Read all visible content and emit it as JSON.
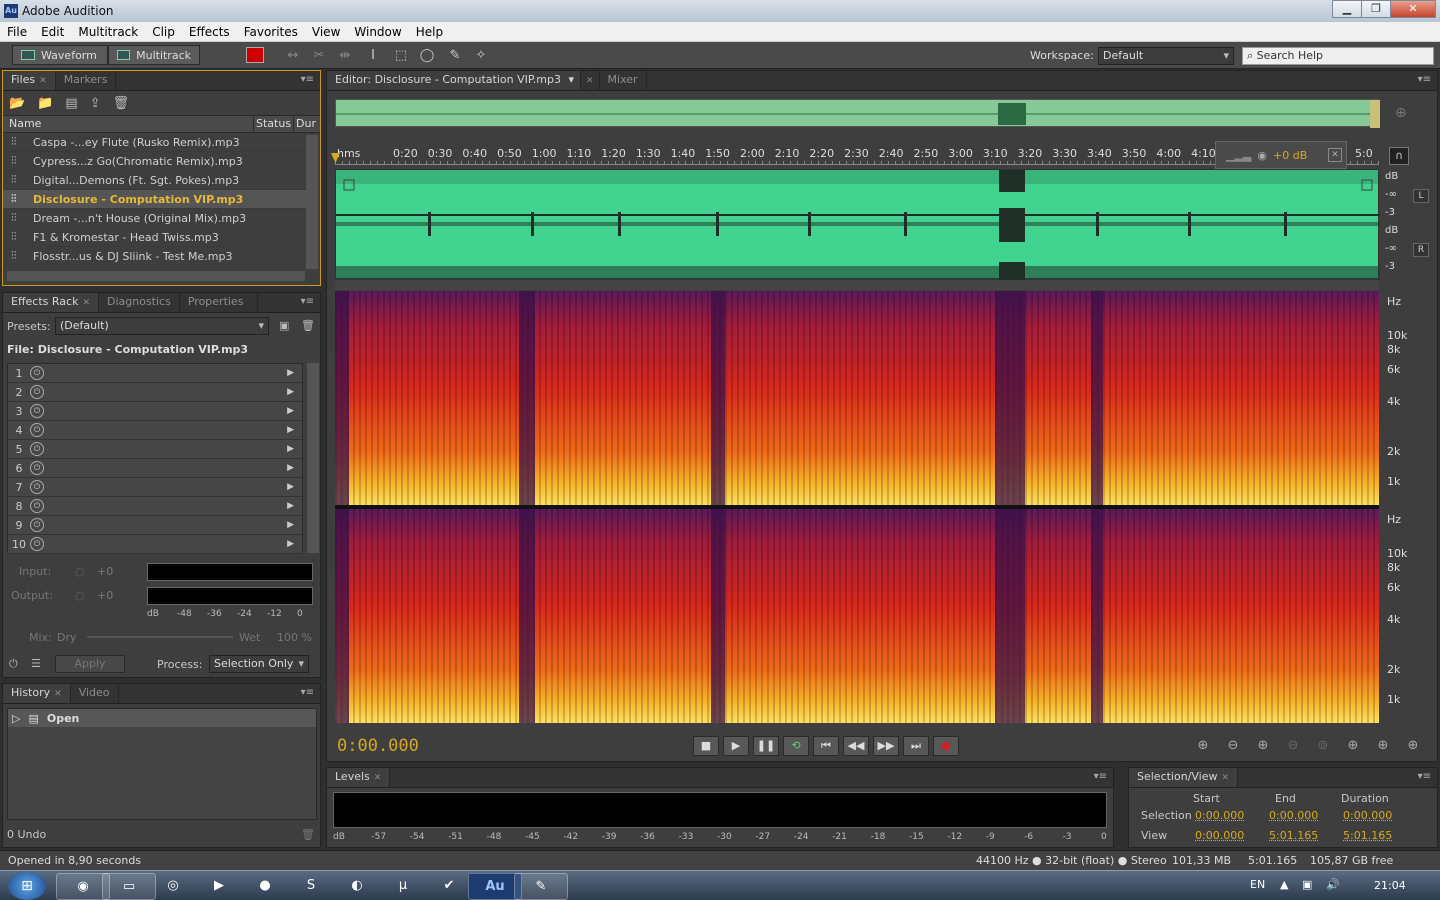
{
  "window": {
    "title": "Adobe Audition",
    "app_icon": "Au"
  },
  "menu": [
    "File",
    "Edit",
    "Multitrack",
    "Clip",
    "Effects",
    "Favorites",
    "View",
    "Window",
    "Help"
  ],
  "toolbar": {
    "waveform": "Waveform",
    "multitrack": "Multitrack",
    "workspace_label": "Workspace:",
    "workspace_value": "Default",
    "search_placeholder": "Search Help"
  },
  "files_panel": {
    "tabs": [
      "Files",
      "Markers"
    ],
    "columns": [
      "Name",
      "Status",
      "Dur"
    ],
    "files": [
      "Caspa -...ey Flute (Rusko Remix).mp3",
      "Cypress...z Go(Chromatic Remix).mp3",
      "Digital...Demons (Ft. Sgt. Pokes).mp3",
      "Disclosure - Computation VIP.mp3",
      "Dream -...n't House (Original Mix).mp3",
      "F1 & Kromestar - Head Twiss.mp3",
      "Flosstr...us & DJ Sliink - Test Me.mp3"
    ],
    "selected_index": 3
  },
  "effects_panel": {
    "tabs": [
      "Effects Rack",
      "Diagnostics",
      "Properties"
    ],
    "presets_label": "Presets:",
    "presets_value": "(Default)",
    "file_label": "File: Disclosure - Computation VIP.mp3",
    "slots": [
      "1",
      "2",
      "3",
      "4",
      "5",
      "6",
      "7",
      "8",
      "9",
      "10"
    ],
    "input_label": "Input:",
    "output_label": "Output:",
    "gain": "+0",
    "db_scale": [
      "dB",
      "-48",
      "-36",
      "-24",
      "-12",
      "0"
    ],
    "mix_label": "Mix:",
    "dry": "Dry",
    "wet": "Wet",
    "wet_pct": "100 %",
    "apply": "Apply",
    "process_label": "Process:",
    "process_value": "Selection Only"
  },
  "history_panel": {
    "tabs": [
      "History",
      "Video"
    ],
    "items": [
      "Open"
    ],
    "undo": "0 Undo"
  },
  "editor": {
    "tab": "Editor: Disclosure - Computation VIP.mp3",
    "mixer_tab": "Mixer",
    "ruler_unit": "hms",
    "ruler": [
      "0:20",
      "0:30",
      "0:40",
      "0:50",
      "1:00",
      "1:10",
      "1:20",
      "1:30",
      "1:40",
      "1:50",
      "2:00",
      "2:10",
      "2:20",
      "2:30",
      "2:40",
      "2:50",
      "3:00",
      "3:10",
      "3:20",
      "3:30",
      "3:40",
      "3:50",
      "4:00",
      "4:10",
      "5:0"
    ],
    "hud_gain": "+0 dB",
    "amp_labels": [
      "dB",
      "-∞",
      "-3",
      "dB",
      "-∞",
      "-3"
    ],
    "channels": [
      "L",
      "R"
    ],
    "hz_labels": [
      "Hz",
      "10k",
      "8k",
      "6k",
      "4k",
      "2k",
      "1k"
    ],
    "time": "0:00.000"
  },
  "levels_panel": {
    "tab": "Levels",
    "scale": [
      "dB",
      "-57",
      "-54",
      "-51",
      "-48",
      "-45",
      "-42",
      "-39",
      "-36",
      "-33",
      "-30",
      "-27",
      "-24",
      "-21",
      "-18",
      "-15",
      "-12",
      "-9",
      "-6",
      "-3",
      "0"
    ]
  },
  "selection_panel": {
    "tab": "Selection/View",
    "headers": [
      "Start",
      "End",
      "Duration"
    ],
    "selection_label": "Selection",
    "view_label": "View",
    "selection": [
      "0:00.000",
      "0:00.000",
      "0:00.000"
    ],
    "view": [
      "0:00.000",
      "5:01.165",
      "5:01.165"
    ]
  },
  "status": {
    "left": "Opened in 8,90 seconds",
    "format": "44100 Hz ● 32-bit (float) ● Stereo",
    "size": "101,33 MB",
    "duration": "5:01.165",
    "free": "105,87 GB free"
  },
  "taskbar": {
    "lang": "EN",
    "clock": "21:04",
    "active_app": "Au"
  }
}
